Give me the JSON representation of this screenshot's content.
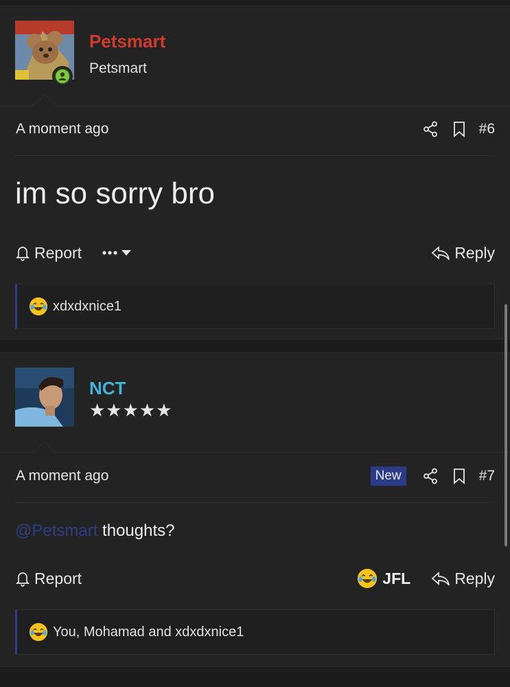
{
  "posts": [
    {
      "username": "Petsmart",
      "username_color": "#d03a2b",
      "user_title": "Petsmart",
      "time": "A moment ago",
      "post_number": "#6",
      "badge": "",
      "message": "im so sorry bro",
      "report_label": "Report",
      "reply_label": "Reply",
      "reactions_text": "xdxdxnice1"
    },
    {
      "username": "NCT",
      "username_color": "#3fb4d6",
      "user_title_stars": "★★★★★",
      "time": "A moment ago",
      "badge": "New",
      "post_number": "#7",
      "mention": "@Petsmart",
      "message": " thoughts?",
      "report_label": "Report",
      "reaction_label": "JFL",
      "reply_label": "Reply",
      "reactions_text": "You, Mohamad and xdxdxnice1"
    }
  ],
  "colors": {
    "accent": "#2d3f85",
    "online": "#7cc943",
    "background": "#232323"
  },
  "icons": [
    "share-icon",
    "bookmark-icon",
    "bell-icon",
    "reply-icon",
    "ellipsis-icon",
    "caret-down-icon",
    "laughing-crying-emoji-icon",
    "online-user-icon"
  ]
}
